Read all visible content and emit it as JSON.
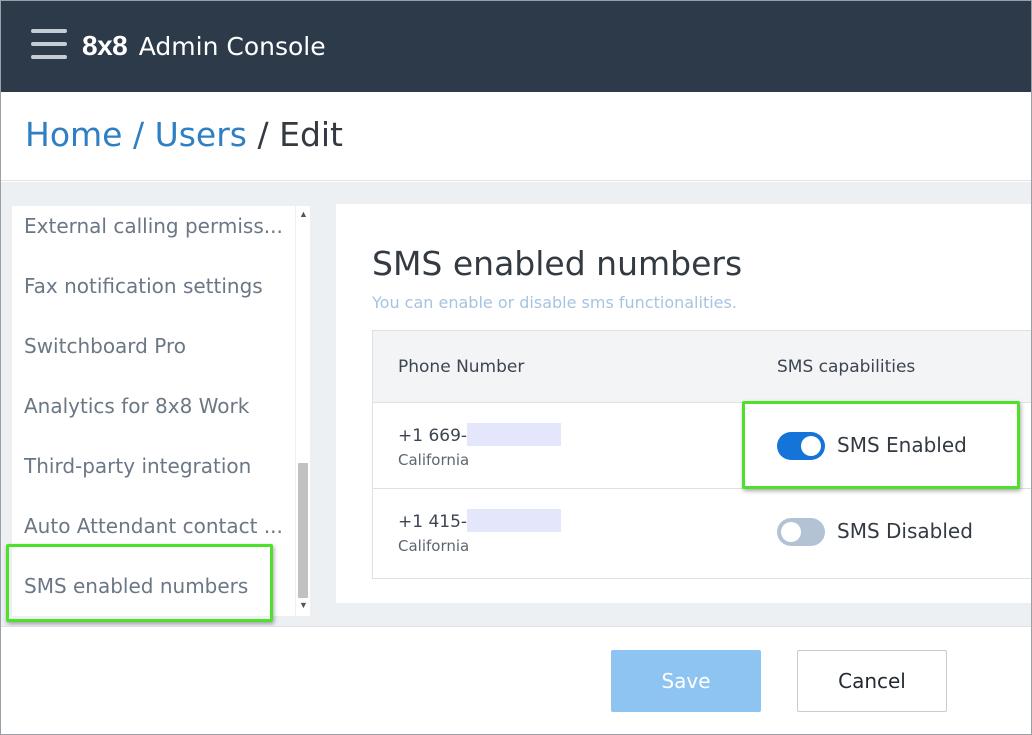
{
  "header": {
    "logo_text": "8x8",
    "title": "Admin Console"
  },
  "breadcrumb": {
    "home": "Home",
    "users": "Users",
    "current": "Edit",
    "separator": "/"
  },
  "sidebar": {
    "items": [
      {
        "label": "External calling permiss..."
      },
      {
        "label": "Fax notification settings"
      },
      {
        "label": "Switchboard Pro"
      },
      {
        "label": "Analytics for 8x8 Work"
      },
      {
        "label": "Third-party integration"
      },
      {
        "label": "Auto Attendant contact ..."
      },
      {
        "label": "SMS enabled numbers"
      }
    ],
    "selected_index": 6
  },
  "main": {
    "title": "SMS enabled numbers",
    "subtitle": "You can enable or disable sms functionalities.",
    "table": {
      "headers": [
        "Phone Number",
        "SMS capabilities"
      ],
      "rows": [
        {
          "phone_prefix": "+1 669-",
          "location": "California",
          "sms_enabled": true,
          "status_label": "SMS Enabled"
        },
        {
          "phone_prefix": "+1 415-",
          "location": "California",
          "sms_enabled": false,
          "status_label": "SMS Disabled"
        }
      ]
    }
  },
  "footer": {
    "save_label": "Save",
    "cancel_label": "Cancel"
  },
  "colors": {
    "header_bg": "#2d3a4a",
    "link": "#2f7fc4",
    "toggle_on": "#1474d8",
    "toggle_off": "#b4c2d6",
    "save_button": "#8ec4f2",
    "highlight": "#4ee02a"
  },
  "icons": [
    "hamburger-menu-icon",
    "scroll-up-arrow-icon",
    "scroll-down-arrow-icon"
  ]
}
